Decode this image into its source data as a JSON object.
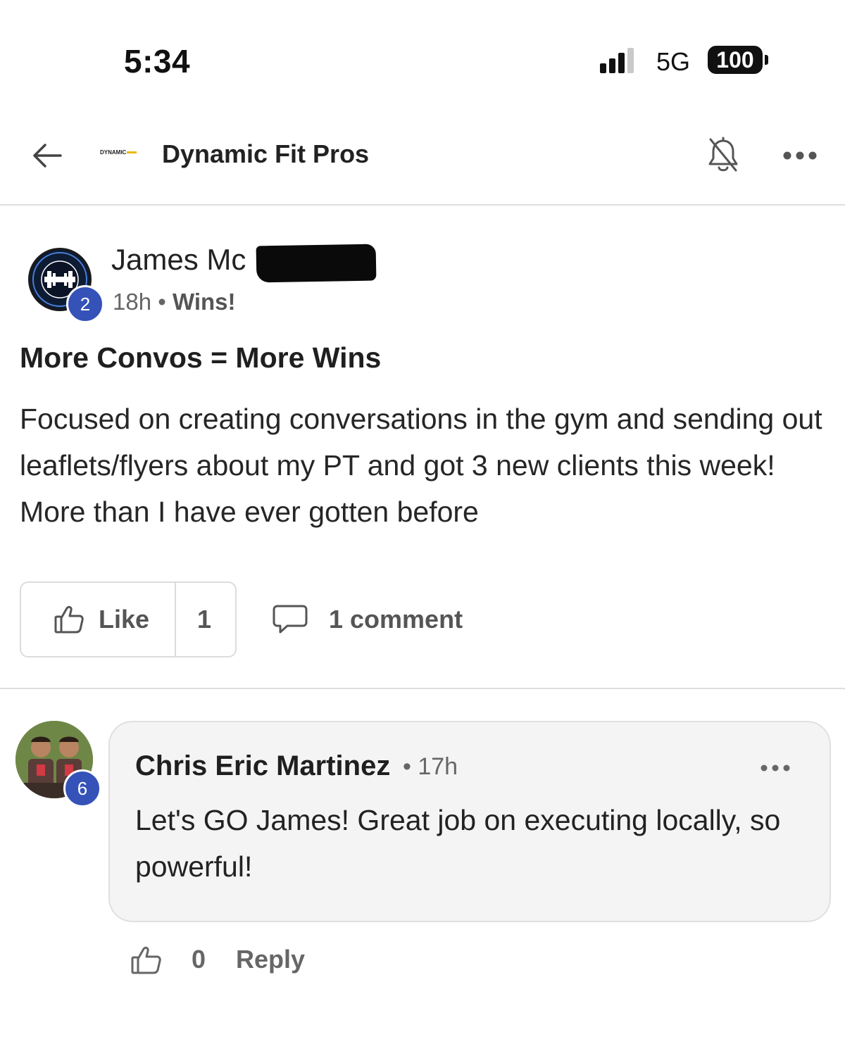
{
  "status_bar": {
    "time": "5:34",
    "network": "5G",
    "battery": "100"
  },
  "header": {
    "group_logo_text": "DYNAMIC",
    "title": "Dynamic Fit Pros",
    "icons": [
      "back-arrow-icon",
      "bell-off-icon",
      "more-horizontal-icon"
    ]
  },
  "post": {
    "author": "James Mc",
    "author_badge": "2",
    "author_avatar_text": "PREMIER FITNESS",
    "time": "18h",
    "separator": "•",
    "category": "Wins!",
    "title": "More Convos = More Wins",
    "body": "Focused on creating conversations in the gym and sending out leaflets/flyers about my PT and got 3 new clients this week! More than I have ever gotten before",
    "like_label": "Like",
    "like_count": "1",
    "comment_count": "1 comment"
  },
  "comment": {
    "author": "Chris Eric Martinez",
    "badge": "6",
    "separator": "•",
    "time": "17h",
    "text": "Let's GO James! Great job on executing locally, so powerful!",
    "like_count": "0",
    "reply_label": "Reply"
  },
  "colors": {
    "badge": "#3552b8",
    "bubble": "#f4f4f4",
    "divider": "#dedede"
  }
}
